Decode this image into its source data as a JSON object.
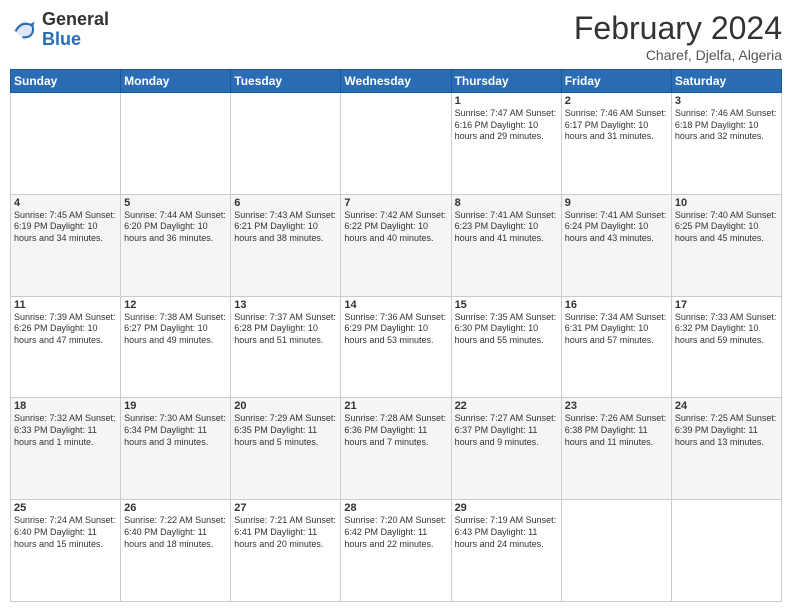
{
  "header": {
    "logo": {
      "general": "General",
      "blue": "Blue"
    },
    "title": "February 2024",
    "location": "Charef, Djelfa, Algeria"
  },
  "days_of_week": [
    "Sunday",
    "Monday",
    "Tuesday",
    "Wednesday",
    "Thursday",
    "Friday",
    "Saturday"
  ],
  "weeks": [
    [
      {
        "num": "",
        "info": ""
      },
      {
        "num": "",
        "info": ""
      },
      {
        "num": "",
        "info": ""
      },
      {
        "num": "",
        "info": ""
      },
      {
        "num": "1",
        "info": "Sunrise: 7:47 AM\nSunset: 6:16 PM\nDaylight: 10 hours\nand 29 minutes."
      },
      {
        "num": "2",
        "info": "Sunrise: 7:46 AM\nSunset: 6:17 PM\nDaylight: 10 hours\nand 31 minutes."
      },
      {
        "num": "3",
        "info": "Sunrise: 7:46 AM\nSunset: 6:18 PM\nDaylight: 10 hours\nand 32 minutes."
      }
    ],
    [
      {
        "num": "4",
        "info": "Sunrise: 7:45 AM\nSunset: 6:19 PM\nDaylight: 10 hours\nand 34 minutes."
      },
      {
        "num": "5",
        "info": "Sunrise: 7:44 AM\nSunset: 6:20 PM\nDaylight: 10 hours\nand 36 minutes."
      },
      {
        "num": "6",
        "info": "Sunrise: 7:43 AM\nSunset: 6:21 PM\nDaylight: 10 hours\nand 38 minutes."
      },
      {
        "num": "7",
        "info": "Sunrise: 7:42 AM\nSunset: 6:22 PM\nDaylight: 10 hours\nand 40 minutes."
      },
      {
        "num": "8",
        "info": "Sunrise: 7:41 AM\nSunset: 6:23 PM\nDaylight: 10 hours\nand 41 minutes."
      },
      {
        "num": "9",
        "info": "Sunrise: 7:41 AM\nSunset: 6:24 PM\nDaylight: 10 hours\nand 43 minutes."
      },
      {
        "num": "10",
        "info": "Sunrise: 7:40 AM\nSunset: 6:25 PM\nDaylight: 10 hours\nand 45 minutes."
      }
    ],
    [
      {
        "num": "11",
        "info": "Sunrise: 7:39 AM\nSunset: 6:26 PM\nDaylight: 10 hours\nand 47 minutes."
      },
      {
        "num": "12",
        "info": "Sunrise: 7:38 AM\nSunset: 6:27 PM\nDaylight: 10 hours\nand 49 minutes."
      },
      {
        "num": "13",
        "info": "Sunrise: 7:37 AM\nSunset: 6:28 PM\nDaylight: 10 hours\nand 51 minutes."
      },
      {
        "num": "14",
        "info": "Sunrise: 7:36 AM\nSunset: 6:29 PM\nDaylight: 10 hours\nand 53 minutes."
      },
      {
        "num": "15",
        "info": "Sunrise: 7:35 AM\nSunset: 6:30 PM\nDaylight: 10 hours\nand 55 minutes."
      },
      {
        "num": "16",
        "info": "Sunrise: 7:34 AM\nSunset: 6:31 PM\nDaylight: 10 hours\nand 57 minutes."
      },
      {
        "num": "17",
        "info": "Sunrise: 7:33 AM\nSunset: 6:32 PM\nDaylight: 10 hours\nand 59 minutes."
      }
    ],
    [
      {
        "num": "18",
        "info": "Sunrise: 7:32 AM\nSunset: 6:33 PM\nDaylight: 11 hours\nand 1 minute."
      },
      {
        "num": "19",
        "info": "Sunrise: 7:30 AM\nSunset: 6:34 PM\nDaylight: 11 hours\nand 3 minutes."
      },
      {
        "num": "20",
        "info": "Sunrise: 7:29 AM\nSunset: 6:35 PM\nDaylight: 11 hours\nand 5 minutes."
      },
      {
        "num": "21",
        "info": "Sunrise: 7:28 AM\nSunset: 6:36 PM\nDaylight: 11 hours\nand 7 minutes."
      },
      {
        "num": "22",
        "info": "Sunrise: 7:27 AM\nSunset: 6:37 PM\nDaylight: 11 hours\nand 9 minutes."
      },
      {
        "num": "23",
        "info": "Sunrise: 7:26 AM\nSunset: 6:38 PM\nDaylight: 11 hours\nand 11 minutes."
      },
      {
        "num": "24",
        "info": "Sunrise: 7:25 AM\nSunset: 6:39 PM\nDaylight: 11 hours\nand 13 minutes."
      }
    ],
    [
      {
        "num": "25",
        "info": "Sunrise: 7:24 AM\nSunset: 6:40 PM\nDaylight: 11 hours\nand 15 minutes."
      },
      {
        "num": "26",
        "info": "Sunrise: 7:22 AM\nSunset: 6:40 PM\nDaylight: 11 hours\nand 18 minutes."
      },
      {
        "num": "27",
        "info": "Sunrise: 7:21 AM\nSunset: 6:41 PM\nDaylight: 11 hours\nand 20 minutes."
      },
      {
        "num": "28",
        "info": "Sunrise: 7:20 AM\nSunset: 6:42 PM\nDaylight: 11 hours\nand 22 minutes."
      },
      {
        "num": "29",
        "info": "Sunrise: 7:19 AM\nSunset: 6:43 PM\nDaylight: 11 hours\nand 24 minutes."
      },
      {
        "num": "",
        "info": ""
      },
      {
        "num": "",
        "info": ""
      }
    ]
  ]
}
